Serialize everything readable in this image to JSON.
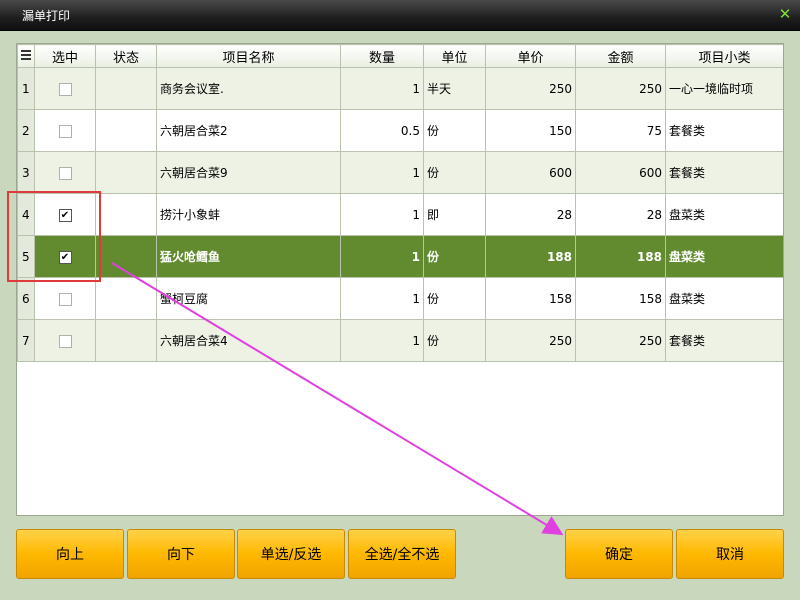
{
  "window": {
    "title": "漏单打印",
    "close_glyph": "✕"
  },
  "table": {
    "headers": [
      "",
      "选中",
      "状态",
      "项目名称",
      "数量",
      "单位",
      "单价",
      "金额",
      "项目小类"
    ],
    "rows": [
      {
        "no": "1",
        "checked": false,
        "status": "",
        "name": "商务会议室.",
        "qty": "1",
        "unit": "半天",
        "price": "250",
        "amount": "250",
        "category": "一心一境临时项"
      },
      {
        "no": "2",
        "checked": false,
        "status": "",
        "name": "六朝居合菜2",
        "qty": "0.5",
        "unit": "份",
        "price": "150",
        "amount": "75",
        "category": "套餐类"
      },
      {
        "no": "3",
        "checked": false,
        "status": "",
        "name": "六朝居合菜9",
        "qty": "1",
        "unit": "份",
        "price": "600",
        "amount": "600",
        "category": "套餐类"
      },
      {
        "no": "4",
        "checked": true,
        "status": "",
        "name": "捞汁小象蚌",
        "qty": "1",
        "unit": "即",
        "price": "28",
        "amount": "28",
        "category": "盘菜类"
      },
      {
        "no": "5",
        "checked": true,
        "status": "",
        "name": "猛火呛鳕鱼",
        "qty": "1",
        "unit": "份",
        "price": "188",
        "amount": "188",
        "category": "盘菜类",
        "selected": true
      },
      {
        "no": "6",
        "checked": false,
        "status": "",
        "name": "蟹柯豆腐",
        "qty": "1",
        "unit": "份",
        "price": "158",
        "amount": "158",
        "category": "盘菜类"
      },
      {
        "no": "7",
        "checked": false,
        "status": "",
        "name": "六朝居合菜4",
        "qty": "1",
        "unit": "份",
        "price": "250",
        "amount": "250",
        "category": "套餐类"
      }
    ]
  },
  "buttons": {
    "up": "向上",
    "down": "向下",
    "toggle": "单选/反选",
    "select_all": "全选/全不选",
    "confirm": "确定",
    "cancel": "取消"
  },
  "colors": {
    "selected_row": "#628b2f",
    "button": "#ffb800",
    "annotation_box": "#e03a3a",
    "annotation_arrow": "#e040e0"
  }
}
